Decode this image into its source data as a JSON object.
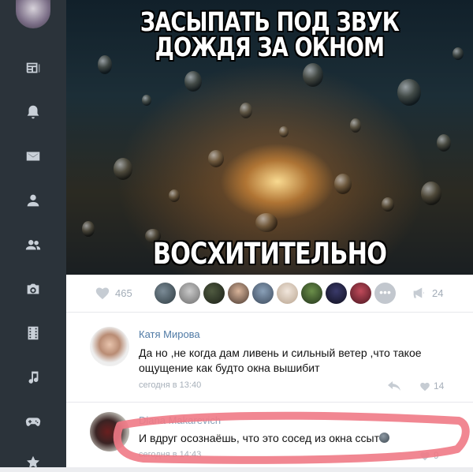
{
  "sidebar": {
    "items": [
      {
        "icon": "news-icon"
      },
      {
        "icon": "bell-icon"
      },
      {
        "icon": "mail-icon"
      },
      {
        "icon": "user-icon"
      },
      {
        "icon": "friends-icon"
      },
      {
        "icon": "camera-icon"
      },
      {
        "icon": "video-icon"
      },
      {
        "icon": "music-icon"
      },
      {
        "icon": "gamepad-icon"
      },
      {
        "icon": "star-icon"
      }
    ]
  },
  "post": {
    "meme_top": "ЗАСЫПАТЬ ПОД ЗВУК ДОЖДЯ ЗА ОКНОМ",
    "meme_bottom": "ВОСХИТИТЕЛЬНО",
    "likes_count": "465",
    "reposts_count": "24"
  },
  "comments": [
    {
      "author": "Катя Мирова",
      "text": "Да но ,не когда дам ливень и сильный ветер ,что такое ощущение как будто окна вышибит",
      "time": "сегодня в 13:40",
      "likes": "14"
    },
    {
      "author": "Diana Makarevich",
      "text": "И вдруг осознаёшь, что это сосед из окна ссыт",
      "time": "сегодня в 14:43",
      "likes": "9"
    }
  ],
  "colors": {
    "sidebar_bg": "#2b333a",
    "link": "#4f7aa5",
    "highlight_stroke": "#ef7a86"
  }
}
